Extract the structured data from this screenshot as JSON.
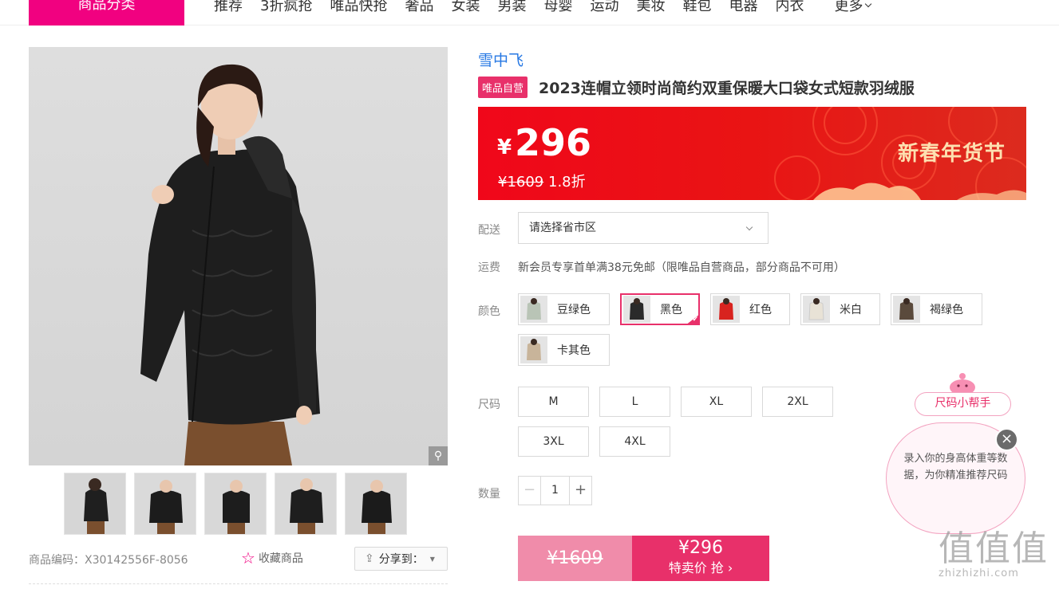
{
  "nav": {
    "category_button": "商品分类",
    "items": [
      "推荐",
      "3折疯抢",
      "唯品快抢",
      "奢品",
      "女装",
      "男装",
      "母婴",
      "运动",
      "美妆",
      "鞋包",
      "电器",
      "内衣"
    ],
    "more": "更多"
  },
  "gallery": {
    "zoom_icon": "magnifier-icon",
    "thumbnail_count": 5
  },
  "meta": {
    "sku": "商品编码：X30142556F-8056",
    "favorite": "收藏商品",
    "share": "分享到："
  },
  "product": {
    "brand": "雪中飞",
    "badge": "唯品自营",
    "title": "2023连帽立领时尚简约双重保暖大口袋女式短款羽绒服"
  },
  "price": {
    "currency": "¥",
    "current": "296",
    "original": "¥1609",
    "discount": "1.8折",
    "festival": "新春年货节"
  },
  "delivery": {
    "label": "配送",
    "placeholder": "请选择省市区"
  },
  "shipping": {
    "label": "运费",
    "text": "新会员专享首单满38元免邮（限唯品自营商品，部分商品不可用）"
  },
  "colors": {
    "label": "颜色",
    "options": [
      {
        "name": "豆绿色",
        "swatch": "#b9c4b6"
      },
      {
        "name": "黑色",
        "swatch": "#2a2a2a",
        "selected": true
      },
      {
        "name": "红色",
        "swatch": "#d8231f"
      },
      {
        "name": "米白",
        "swatch": "#e8e2d6"
      },
      {
        "name": "褐绿色",
        "swatch": "#5a4a3c"
      },
      {
        "name": "卡其色",
        "swatch": "#c8b49a"
      }
    ]
  },
  "sizes": {
    "label": "尺码",
    "options": [
      "M",
      "L",
      "XL",
      "2XL",
      "3XL",
      "4XL"
    ]
  },
  "quantity": {
    "label": "数量",
    "value": "1",
    "minus": "−",
    "plus": "+"
  },
  "buy": {
    "original": "¥1609",
    "price": "¥296",
    "action": "特卖价 抢 ›"
  },
  "size_helper": {
    "tag": "尺码小帮手",
    "text": "录入你的身高体重等数据，为你精准推荐尺码",
    "close": "×"
  },
  "watermark": {
    "big": "值值值",
    "small": "zhizhizhi.com"
  },
  "colors_theme": {
    "accent": "#f10180",
    "pink": "#e8306a",
    "brand_blue": "#2577e3",
    "banner_red": "#eb1515"
  }
}
